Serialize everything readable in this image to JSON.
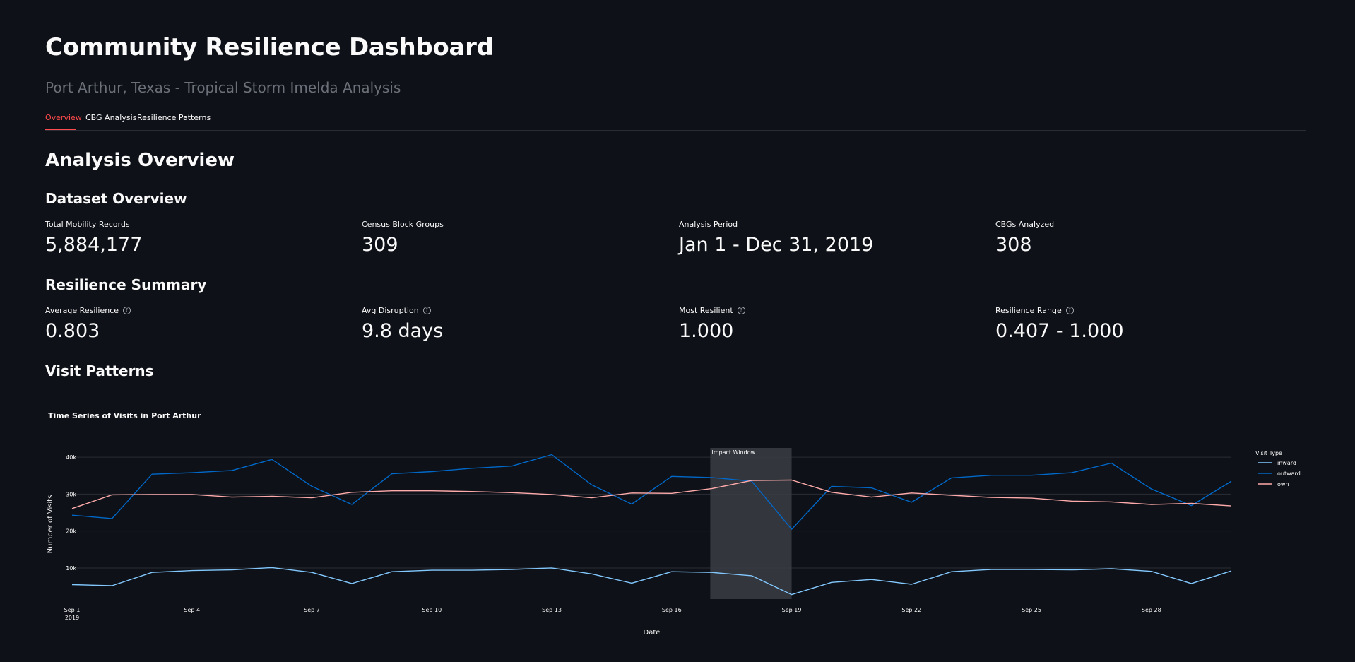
{
  "header": {
    "title": "Community Resilience Dashboard",
    "subtitle": "Port Arthur, Texas - Tropical Storm Imelda Analysis"
  },
  "tabs": [
    {
      "label": "Overview",
      "active": true
    },
    {
      "label": "CBG Analysis",
      "active": false
    },
    {
      "label": "Resilience Patterns",
      "active": false
    }
  ],
  "overview": {
    "heading": "Analysis Overview",
    "dataset": {
      "heading": "Dataset Overview",
      "metrics": [
        {
          "label": "Total Mobility Records",
          "value": "5,884,177"
        },
        {
          "label": "Census Block Groups",
          "value": "309"
        },
        {
          "label": "Analysis Period",
          "value": "Jan 1 - Dec 31, 2019"
        },
        {
          "label": "CBGs Analyzed",
          "value": "308"
        }
      ]
    },
    "resilience": {
      "heading": "Resilience Summary",
      "metrics": [
        {
          "label": "Average Resilience",
          "value": "0.803",
          "help_icon": "question-circle-icon"
        },
        {
          "label": "Avg Disruption",
          "value": "9.8 days",
          "help_icon": "question-circle-icon"
        },
        {
          "label": "Most Resilient",
          "value": "1.000",
          "help_icon": "question-circle-icon"
        },
        {
          "label": "Resilience Range",
          "value": "0.407 - 1.000",
          "help_icon": "question-circle-icon"
        }
      ]
    },
    "visits_heading": "Visit Patterns"
  },
  "colors": {
    "background": "#0e1117",
    "accent": "#ff4b4b",
    "inward": "#83c9ff",
    "outward": "#0068c9",
    "own": "#ffabab",
    "impact_window": "#3a3d44"
  },
  "chart_data": {
    "type": "line",
    "title": "Time Series of Visits in Port Arthur",
    "xlabel": "Date",
    "ylabel": "Number of Visits",
    "legend_title": "Visit Type",
    "legend_position": "right",
    "x": [
      "2019-09-01",
      "2019-09-02",
      "2019-09-03",
      "2019-09-04",
      "2019-09-05",
      "2019-09-06",
      "2019-09-07",
      "2019-09-08",
      "2019-09-09",
      "2019-09-10",
      "2019-09-11",
      "2019-09-12",
      "2019-09-13",
      "2019-09-14",
      "2019-09-15",
      "2019-09-16",
      "2019-09-17",
      "2019-09-18",
      "2019-09-19",
      "2019-09-20",
      "2019-09-21",
      "2019-09-22",
      "2019-09-23",
      "2019-09-24",
      "2019-09-25",
      "2019-09-26",
      "2019-09-27",
      "2019-09-28",
      "2019-09-29",
      "2019-09-30"
    ],
    "x_ticks": [
      {
        "date": "2019-09-01",
        "label": "Sep 1",
        "sublabel": "2019"
      },
      {
        "date": "2019-09-04",
        "label": "Sep 4"
      },
      {
        "date": "2019-09-07",
        "label": "Sep 7"
      },
      {
        "date": "2019-09-10",
        "label": "Sep 10"
      },
      {
        "date": "2019-09-13",
        "label": "Sep 13"
      },
      {
        "date": "2019-09-16",
        "label": "Sep 16"
      },
      {
        "date": "2019-09-19",
        "label": "Sep 19"
      },
      {
        "date": "2019-09-22",
        "label": "Sep 22"
      },
      {
        "date": "2019-09-25",
        "label": "Sep 25"
      },
      {
        "date": "2019-09-28",
        "label": "Sep 28"
      }
    ],
    "y_ticks": [
      {
        "value": 10000,
        "label": "10k"
      },
      {
        "value": 20000,
        "label": "20k"
      },
      {
        "value": 30000,
        "label": "30k"
      },
      {
        "value": 40000,
        "label": "40k"
      }
    ],
    "ylim": [
      1000,
      42700
    ],
    "grid": true,
    "impact_window": {
      "start": "2019-09-17",
      "end": "2019-09-19",
      "label": "Impact Window"
    },
    "series": [
      {
        "name": "inward",
        "color": "#83c9ff",
        "values": [
          5500,
          5200,
          8800,
          9300,
          9500,
          10100,
          8800,
          5800,
          9000,
          9400,
          9400,
          9600,
          10000,
          8400,
          5900,
          9000,
          8800,
          7900,
          2800,
          6100,
          6900,
          5600,
          9000,
          9600,
          9600,
          9500,
          9800,
          9100,
          5800,
          9200
        ]
      },
      {
        "name": "outward",
        "color": "#0068c9",
        "values": [
          24300,
          23400,
          35400,
          35800,
          36400,
          39400,
          32100,
          27200,
          35500,
          36100,
          37000,
          37600,
          40700,
          32500,
          27300,
          34800,
          34500,
          33500,
          20500,
          32100,
          31700,
          27800,
          34400,
          35100,
          35100,
          35800,
          38400,
          31400,
          26900,
          33500
        ]
      },
      {
        "name": "own",
        "color": "#ffabab",
        "values": [
          26100,
          29800,
          29900,
          29900,
          29200,
          29400,
          29000,
          30500,
          30900,
          30900,
          30700,
          30400,
          29900,
          29000,
          30300,
          30200,
          31500,
          33700,
          33800,
          30500,
          29200,
          30300,
          29700,
          29100,
          28900,
          28100,
          27900,
          27200,
          27500,
          26800
        ]
      }
    ]
  }
}
